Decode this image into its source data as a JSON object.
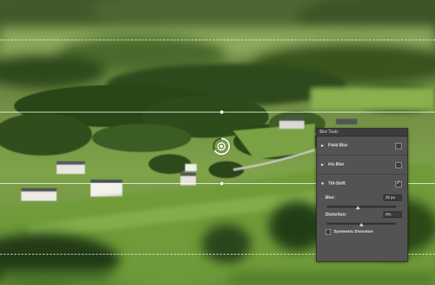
{
  "panel": {
    "title": "Blur Tools",
    "sections": [
      {
        "label": "Field Blur",
        "expanded": false,
        "enabled": false
      },
      {
        "label": "Iris Blur",
        "expanded": false,
        "enabled": false
      },
      {
        "label": "Tilt-Shift",
        "expanded": true,
        "enabled": true
      }
    ],
    "tilt_shift": {
      "blur_label": "Blur:",
      "blur_value": "25 px",
      "blur_slider_fraction": 0.45,
      "distortion_label": "Distortion:",
      "distortion_value": "0%",
      "distortion_slider_fraction": 0.5,
      "symmetric_label": "Symmetric Distortion",
      "symmetric_checked": false
    }
  },
  "colors": {
    "panel_bg": "#535353",
    "panel_header_bg": "#3c3c3c",
    "guide_line": "#ffffff"
  },
  "icons": [
    "blur-pin-icon",
    "expand-triangle-icon",
    "collapse-triangle-icon",
    "checkmark-icon"
  ]
}
